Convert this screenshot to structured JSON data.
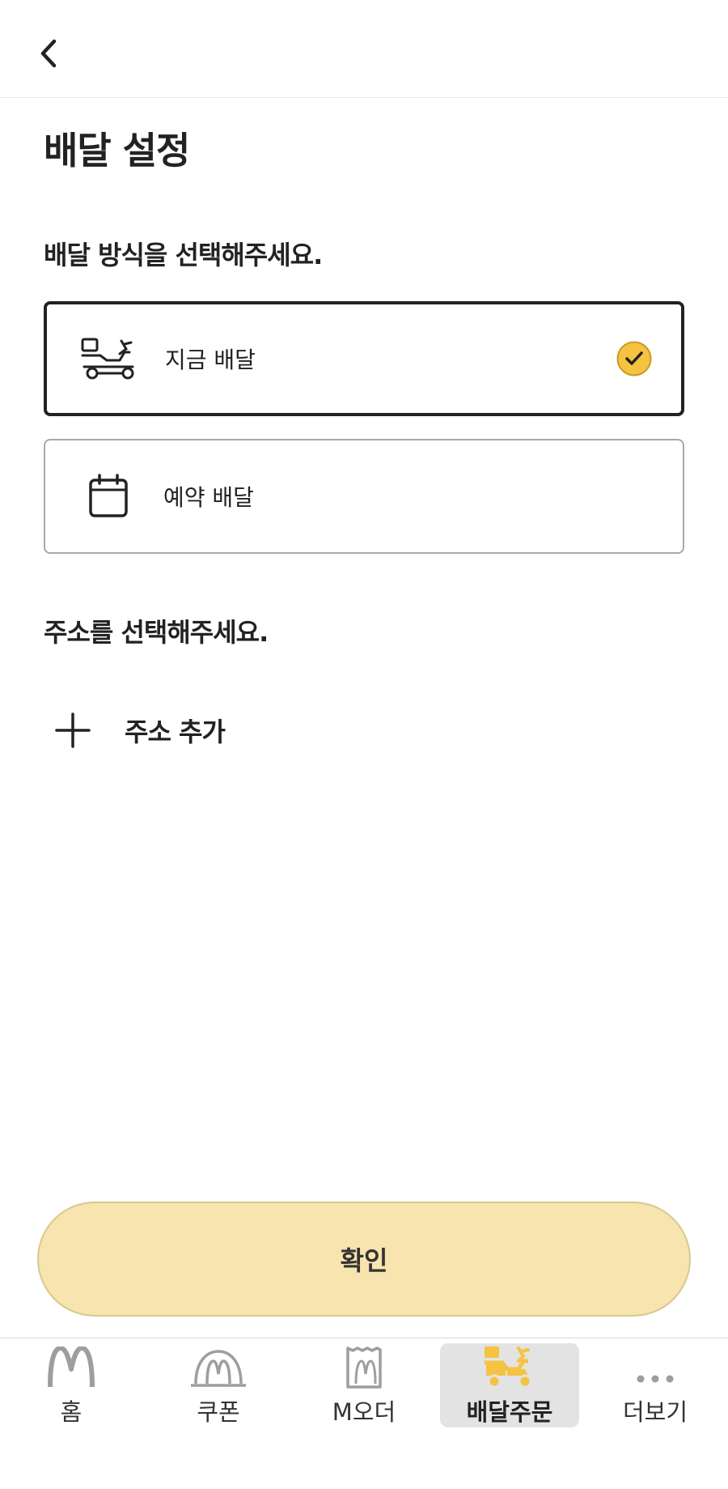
{
  "header": {
    "back_icon": "chevron-left-icon"
  },
  "page_title": "배달 설정",
  "delivery_method": {
    "section_title": "배달 방식을 선택해주세요.",
    "options": [
      {
        "label": "지금 배달",
        "icon": "scooter-icon",
        "selected": true
      },
      {
        "label": "예약 배달",
        "icon": "calendar-icon",
        "selected": false
      }
    ]
  },
  "address": {
    "section_title": "주소를 선택해주세요.",
    "add_label": "주소 추가"
  },
  "confirm_label": "확인",
  "colors": {
    "accent": "#f5c242",
    "confirm_bg": "#f7e4ae",
    "text": "#222222",
    "nav_active_bg": "#e3e3e3"
  },
  "bottom_nav": {
    "items": [
      {
        "label": "홈",
        "icon": "golden-arches-icon",
        "active": false
      },
      {
        "label": "쿠폰",
        "icon": "coupon-icon",
        "active": false
      },
      {
        "label": "M오더",
        "icon": "mobile-order-bag-icon",
        "active": false
      },
      {
        "label": "배달주문",
        "icon": "delivery-scooter-icon",
        "active": true
      },
      {
        "label": "더보기",
        "icon": "more-dots-icon",
        "active": false
      }
    ]
  }
}
